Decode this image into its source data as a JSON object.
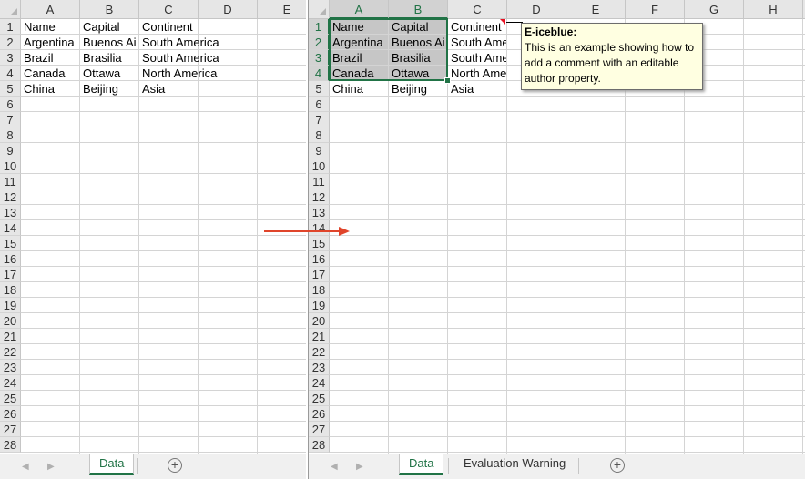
{
  "colors": {
    "accent_green": "#217346",
    "header_bg": "#e6e6e6",
    "selected_header_bg": "#d2d2d2",
    "selected_cell_bg": "#c6c6c6",
    "comment_bg": "#ffffe1",
    "comment_indicator": "#e81123",
    "arrow": "#e0452b"
  },
  "left_sheet": {
    "columns": [
      "A",
      "B",
      "C",
      "D",
      "E"
    ],
    "rows": [
      "1",
      "2",
      "3",
      "4",
      "5",
      "6",
      "7",
      "8",
      "9",
      "10",
      "11",
      "12",
      "13",
      "14",
      "15",
      "16",
      "17",
      "18",
      "19",
      "20",
      "21",
      "22",
      "23",
      "24",
      "25",
      "26",
      "27",
      "28"
    ],
    "cells": [
      [
        "Name",
        "Capital",
        "Continent"
      ],
      [
        "Argentina",
        "Buenos Ai",
        "South America"
      ],
      [
        "Brazil",
        "Brasilia",
        "South America"
      ],
      [
        "Canada",
        "Ottawa",
        "North America"
      ],
      [
        "China",
        "Beijing",
        "Asia"
      ]
    ],
    "tabs": [
      {
        "label": "Data",
        "active": true
      }
    ]
  },
  "right_sheet": {
    "columns": [
      "A",
      "B",
      "C",
      "D",
      "E",
      "F",
      "G",
      "H"
    ],
    "rows": [
      "1",
      "2",
      "3",
      "4",
      "5",
      "6",
      "7",
      "8",
      "9",
      "10",
      "11",
      "12",
      "13",
      "14",
      "15",
      "16",
      "17",
      "18",
      "19",
      "20",
      "21",
      "22",
      "23",
      "24",
      "25",
      "26",
      "27",
      "28"
    ],
    "cells": [
      [
        "Name",
        "Capital",
        "Continent"
      ],
      [
        "Argentina",
        "Buenos Ai",
        "South Americ"
      ],
      [
        "Brazil",
        "Brasilia",
        "South Americ"
      ],
      [
        "Canada",
        "Ottawa",
        "North Americ"
      ],
      [
        "China",
        "Beijing",
        "Asia"
      ]
    ],
    "selected_columns": [
      "A",
      "B"
    ],
    "selected_rows": [
      "1",
      "2",
      "3",
      "4"
    ],
    "tabs": [
      {
        "label": "Data",
        "active": true
      },
      {
        "label": "Evaluation Warning",
        "active": false
      }
    ],
    "comment": {
      "author": "E-iceblue:",
      "text": "This is an example showing how to add a comment with an editable author property."
    }
  },
  "icons": {
    "nav_prev": "caret-left-icon",
    "nav_next": "caret-right-icon",
    "add_sheet": "plus-circle-icon",
    "transform_arrow": "right-arrow-icon"
  }
}
